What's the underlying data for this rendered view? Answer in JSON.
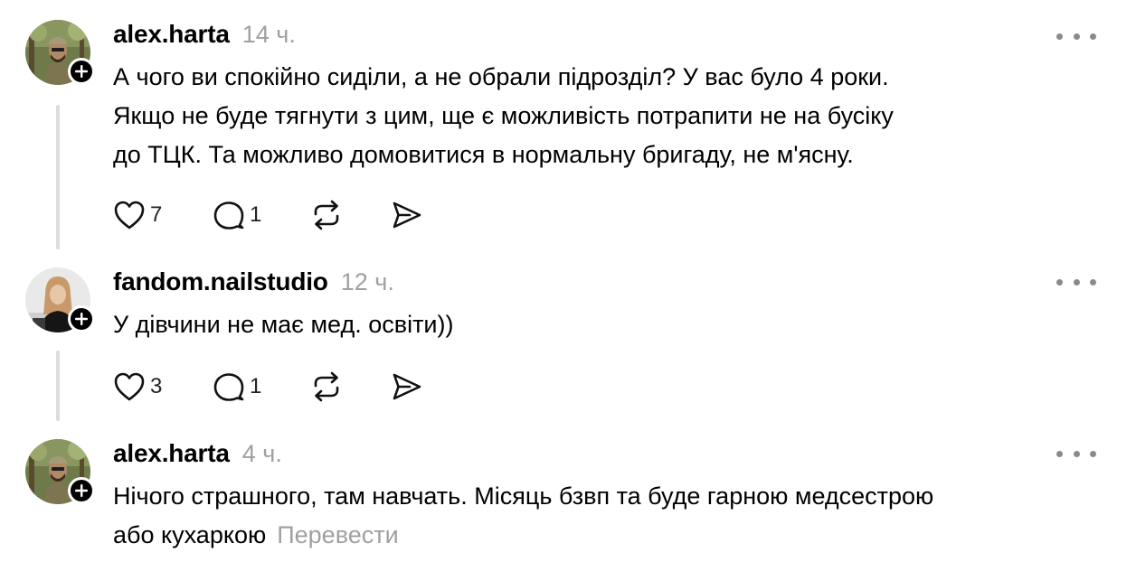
{
  "comments": [
    {
      "username": "alex.harta",
      "time": "14 ч.",
      "lines": [
        "А чого ви спокійно сиділи, а не обрали підрозділ? У вас було 4 роки.",
        "Якщо не буде тягнути з цим, ще є можливість потрапити не на бусіку",
        "до ТЦК. Та можливо домовитися в нормальну бригаду, не м'ясну."
      ],
      "likes": "7",
      "replies": "1",
      "avatar_icon": "soldier-avatar"
    },
    {
      "username": "fandom.nailstudio",
      "time": "12 ч.",
      "lines": [
        "У дівчини не має мед. освіти))"
      ],
      "likes": "3",
      "replies": "1",
      "avatar_icon": "girl-avatar"
    },
    {
      "username": "alex.harta",
      "time": "4 ч.",
      "lines": [
        "Нічого страшного, там навчать. Місяць бзвп та буде гарною медсестрою",
        "або кухаркою"
      ],
      "translate_label": "Перевести",
      "avatar_icon": "soldier-avatar"
    }
  ],
  "icons": {
    "like": "heart-icon",
    "reply": "comment-icon",
    "repost": "repost-icon",
    "share": "send-icon",
    "more": "more-dots-icon",
    "follow": "plus-icon"
  },
  "colors": {
    "text": "#000000",
    "muted": "#a0a0a0",
    "thread_line": "#dcdcdc"
  }
}
